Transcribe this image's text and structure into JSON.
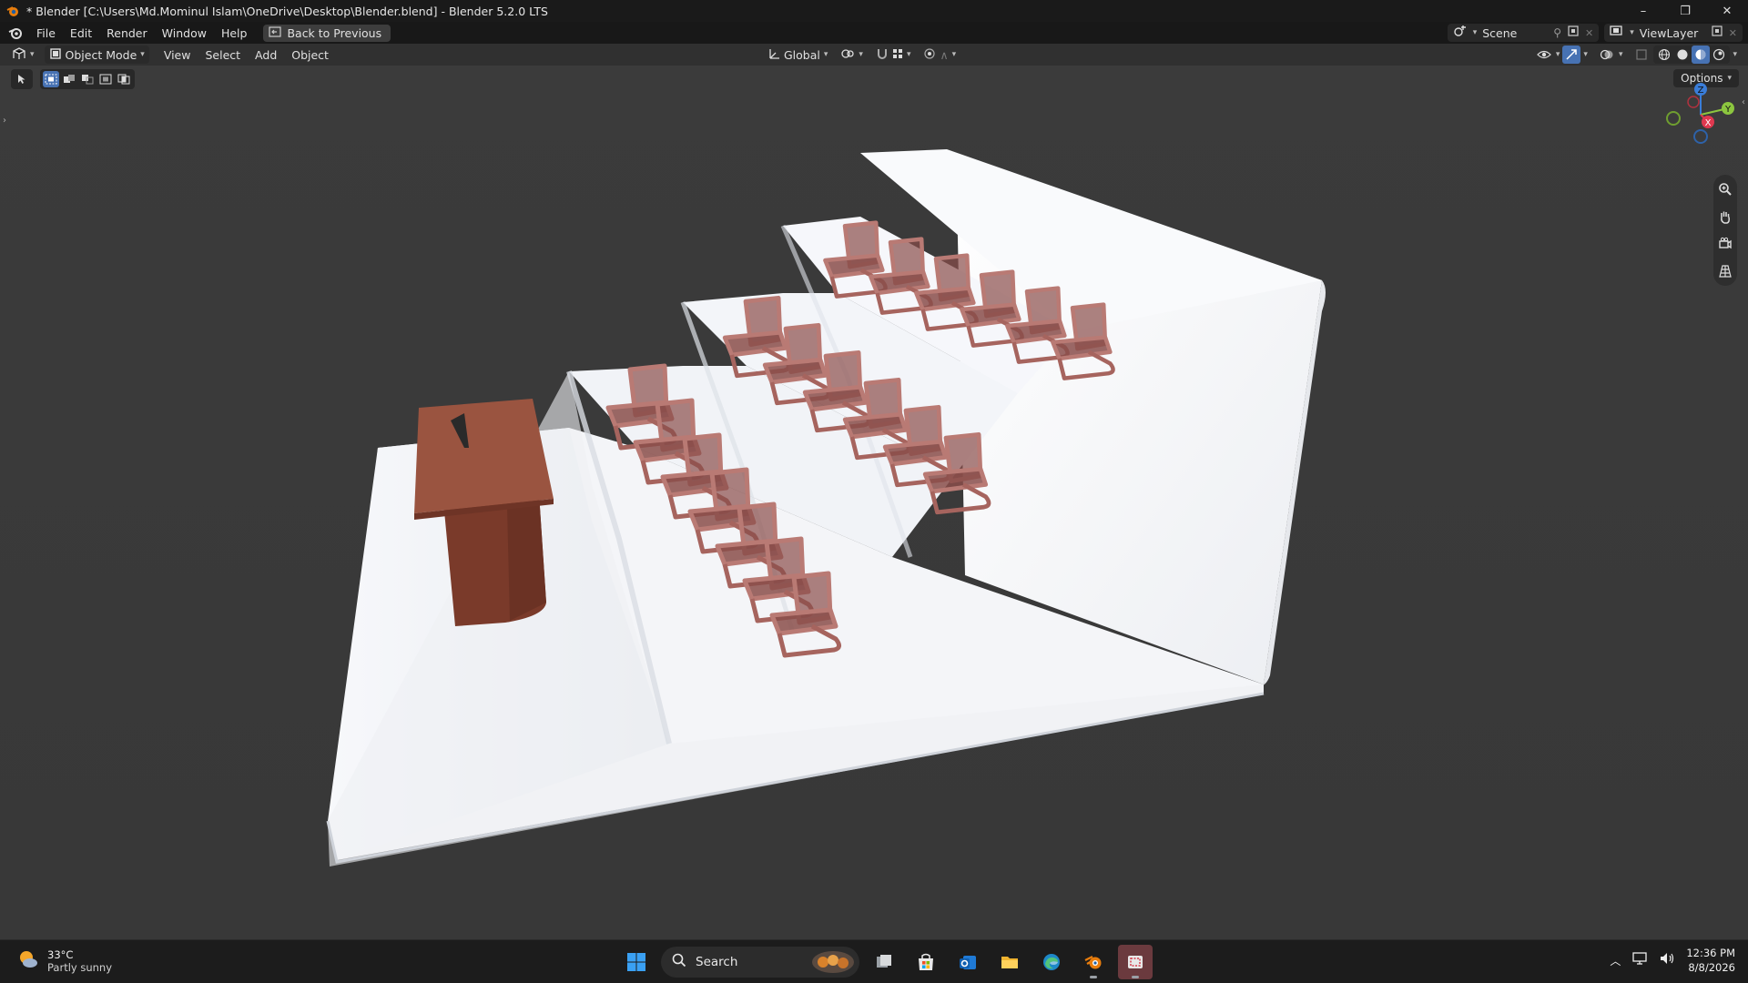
{
  "titlebar": {
    "title": "* Blender [C:\\Users\\Md.Mominul Islam\\OneDrive\\Desktop\\Blender.blend] - Blender 5.2.0 LTS",
    "minimize": "–",
    "maximize": "❐",
    "close": "✕"
  },
  "menu": {
    "items": [
      "File",
      "Edit",
      "Render",
      "Window",
      "Help"
    ],
    "back_button": "Back to Previous"
  },
  "scene": {
    "name": "Scene",
    "view_layer": "ViewLayer"
  },
  "viewport_header": {
    "mode": "Object Mode",
    "menus": [
      "View",
      "Select",
      "Add",
      "Object"
    ],
    "orientation": "Global"
  },
  "viewport": {
    "options_label": "Options",
    "gizmo_axes": [
      "Z",
      "Y",
      "X"
    ]
  },
  "taskbar": {
    "weather_temp": "33°C",
    "weather_desc": "Partly sunny",
    "search_label": "Search",
    "time": "12:36 PM",
    "date": "8/8/2026"
  },
  "colors": {
    "accent": "#4772b3",
    "chair": "#8a4d4a",
    "podium": "#8b4a38",
    "steps": "#f4f6fa",
    "axis_x": "#e0384f",
    "axis_y": "#8cc63f",
    "axis_z": "#3a7dd8"
  }
}
